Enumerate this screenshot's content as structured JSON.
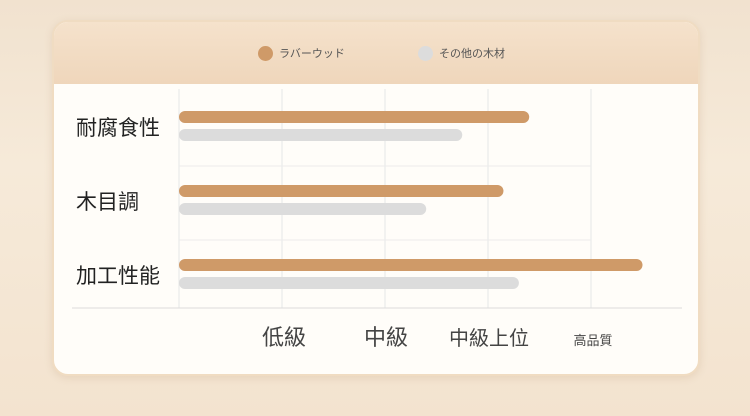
{
  "chart_data": {
    "type": "bar",
    "orientation": "horizontal",
    "categories": [
      "耐腐食性",
      "木目調",
      "加工性能"
    ],
    "series": [
      {
        "name": "ラバーウッド",
        "color": "#cf9a68",
        "values": [
          3.4,
          3.15,
          4.5
        ]
      },
      {
        "name": "その他の木材",
        "color": "#dcdcdc",
        "values": [
          2.75,
          2.4,
          3.3
        ]
      }
    ],
    "x_tick_labels": [
      "低級",
      "中級",
      "中級上位",
      "高品質"
    ],
    "xlim": [
      0,
      4.8
    ],
    "grid": true,
    "legend_position": "top"
  }
}
